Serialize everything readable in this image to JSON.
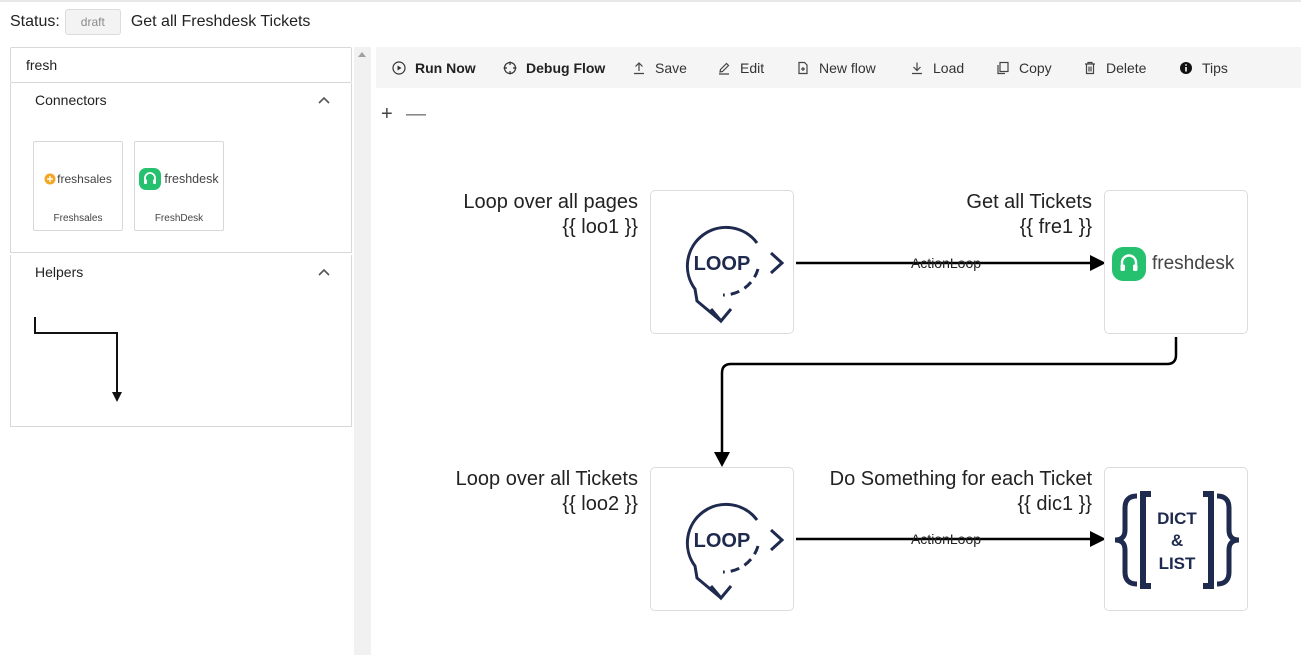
{
  "status": {
    "label": "Status:",
    "badge": "draft",
    "flow_title": "Get all Freshdesk Tickets"
  },
  "search": {
    "value": "fresh",
    "placeholder": ""
  },
  "connectors": {
    "title": "Connectors",
    "items": [
      {
        "logo_text": "freshsales",
        "label": "Freshsales"
      },
      {
        "logo_text": "freshdesk",
        "label": "FreshDesk"
      }
    ]
  },
  "helpers": {
    "title": "Helpers"
  },
  "toolbar": {
    "run_now": "Run Now",
    "debug_flow": "Debug Flow",
    "save": "Save",
    "edit": "Edit",
    "new_flow": "New flow",
    "load": "Load",
    "copy": "Copy",
    "delete": "Delete",
    "tips": "Tips"
  },
  "zoom": {
    "in": "+",
    "out": "—"
  },
  "nodes": {
    "loop1": {
      "title": "Loop over all pages",
      "ref": "{{ loo1 }}",
      "icon_text": "LOOP"
    },
    "fresh1": {
      "title": "Get all Tickets",
      "ref": "{{ fre1 }}",
      "logo_text": "freshdesk"
    },
    "loop2": {
      "title": "Loop over all Tickets",
      "ref": "{{ loo2 }}",
      "icon_text": "LOOP"
    },
    "dict1": {
      "title": "Do Something for each Ticket",
      "ref": "{{ dic1 }}",
      "icon_lines": [
        "DICT",
        "&",
        "LIST"
      ]
    }
  },
  "edges": {
    "label_1": "ActionLoop",
    "label_2": "ActionLoop"
  },
  "colors": {
    "navy": "#1f2a4f",
    "freshdesk_green": "#25c16f",
    "freshsales_orange": "#f5a623"
  }
}
